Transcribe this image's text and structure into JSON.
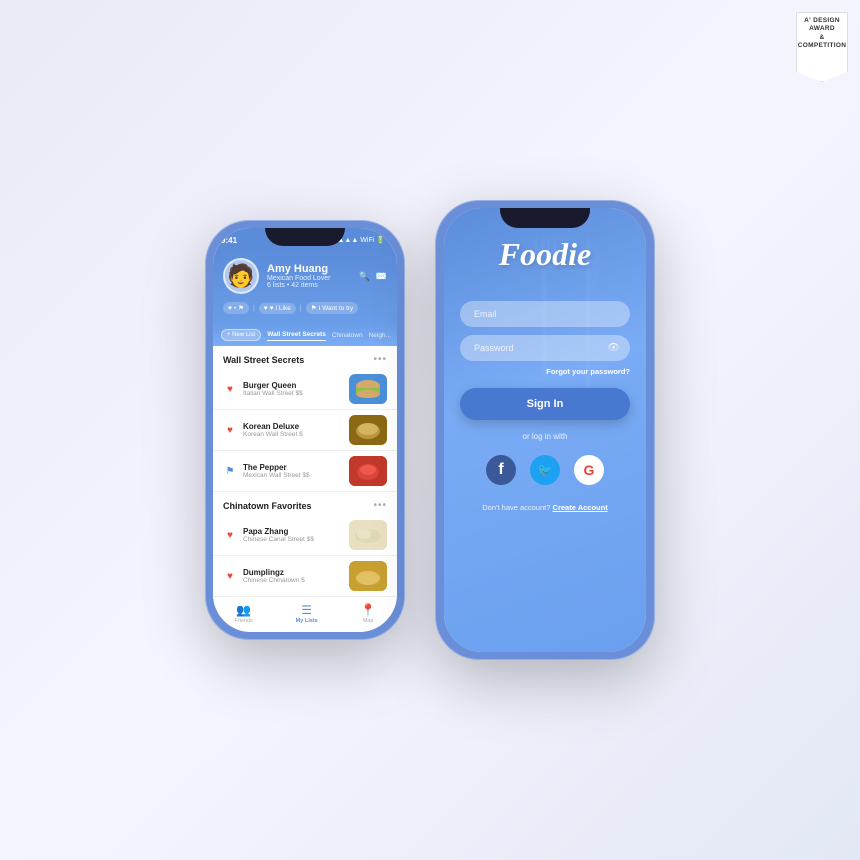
{
  "award": {
    "line1": "A' DESIGN AWARD",
    "line2": "& COMPETITION"
  },
  "left_phone": {
    "status_bar": {
      "time": "9:41",
      "signal": "●●●",
      "wifi": "WiFi",
      "battery": "■"
    },
    "profile": {
      "name": "Amy Huang",
      "subtitle": "Mexican Food Lover",
      "stats": "6 lists • 42 items"
    },
    "stat_buttons": {
      "favorites": "♥ • ⚑",
      "i_like": "♥  I Like",
      "want_to_try": "⚑  I Want to try"
    },
    "filter_tabs": {
      "new_list": "+ New List",
      "tab1": "Wall Street Secrets",
      "tab2": "Chinatown",
      "tab3": "Neigh..."
    },
    "sections": [
      {
        "title": "Wall Street Secrets",
        "items": [
          {
            "name": "Burger Queen",
            "sub": "Italian  Wall Street  $$",
            "icon": "❤️"
          },
          {
            "name": "Korean Deluxe",
            "sub": "Korean  Wall Street  $",
            "icon": "❤️"
          },
          {
            "name": "The Pepper",
            "sub": "Mexican  Wall Street  $$",
            "icon": "🚩"
          }
        ]
      },
      {
        "title": "Chinatown Favorites",
        "items": [
          {
            "name": "Papa Zhang",
            "sub": "Chinese  Canal Street  $$",
            "icon": "❤️"
          },
          {
            "name": "Dumplingz",
            "sub": "Chinese  Chinatown  $",
            "icon": "❤️"
          }
        ]
      }
    ],
    "bottom_nav": [
      {
        "label": "Friends",
        "icon": "👥"
      },
      {
        "label": "My Lists",
        "icon": "☰",
        "active": true
      },
      {
        "label": "Map",
        "icon": "📍"
      }
    ]
  },
  "right_phone": {
    "logo": "Foodie",
    "email_placeholder": "Email",
    "password_placeholder": "Password",
    "forgot_label": "Forgot your password?",
    "signin_label": "Sign In",
    "or_label": "or log in with",
    "social": {
      "facebook": "f",
      "twitter": "t",
      "google": "G"
    },
    "signup_text": "Don't have account?",
    "signup_link": "Create Account"
  }
}
